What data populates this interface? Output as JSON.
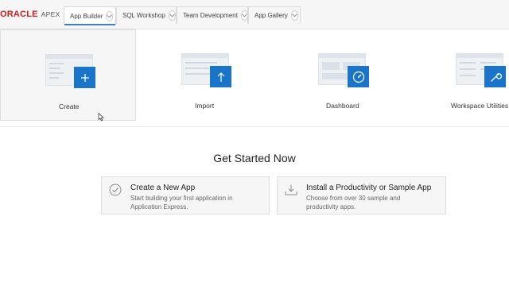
{
  "header": {
    "brand": "ORACLE",
    "product": "APEX",
    "tabs": [
      {
        "label": "App Builder",
        "active": true
      },
      {
        "label": "SQL Workshop",
        "active": false
      },
      {
        "label": "Team Development",
        "active": false
      },
      {
        "label": "App Gallery",
        "active": false
      }
    ]
  },
  "tiles": [
    {
      "label": "Create",
      "icon": "plus-icon"
    },
    {
      "label": "Import",
      "icon": "upload-arrow-icon"
    },
    {
      "label": "Dashboard",
      "icon": "gauge-icon"
    },
    {
      "label": "Workspace Utilities",
      "icon": "wrench-icon"
    }
  ],
  "get_started": {
    "title": "Get Started Now",
    "cards": [
      {
        "title": "Create a New App",
        "description": "Start building your first application in Application Express.",
        "icon": "check-circle-icon"
      },
      {
        "title": "Install a Productivity or Sample App",
        "description": "Choose from over 30 sample and productivity apps.",
        "icon": "download-tray-icon"
      }
    ]
  },
  "colors": {
    "accent": "#1a75ca",
    "brand_red": "#cc2222",
    "tab_active_underline": "#3f7fc4"
  }
}
